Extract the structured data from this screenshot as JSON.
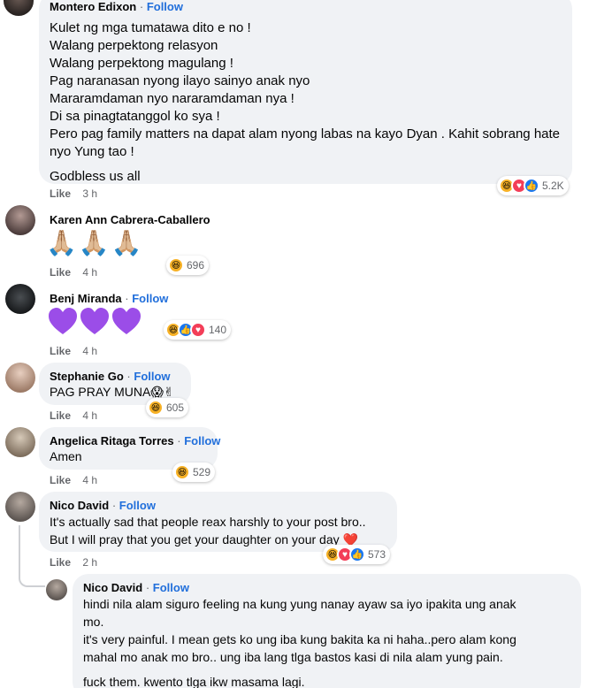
{
  "comments": [
    {
      "author": "Montero Edixon",
      "follow": "Follow",
      "lines": [
        "Kulet ng mga tumatawa dito e no !",
        "Walang perpektong relasyon",
        "Walang perpektong magulang !",
        "Pag naranasan nyong ilayo sainyo anak nyo",
        "Mararamdaman nyo nararamdaman nya !",
        "Di sa pinagtatanggol ko sya !",
        "Pero pag family matters na dapat alam nyong labas na kayo Dyan . Kahit sobrang hate",
        "nyo Yung tao !",
        "Godbless us all"
      ],
      "like": "Like",
      "time": "3 h",
      "reaction_count": "5.2K"
    },
    {
      "author": "Karen Ann Cabrera-Caballero",
      "text": "🙏🏼🙏🏼🙏🏼",
      "like": "Like",
      "time": "4 h",
      "reaction_count": "696"
    },
    {
      "author": "Benj Miranda",
      "follow": "Follow",
      "like": "Like",
      "time": "4 h",
      "reaction_count": "140"
    },
    {
      "author": "Stephanie Go",
      "follow": "Follow",
      "text": "PAG PRAY MUNA😱✌",
      "like": "Like",
      "time": "4 h",
      "reaction_count": "605"
    },
    {
      "author": "Angelica Ritaga Torres",
      "follow": "Follow",
      "text": "Amen",
      "like": "Like",
      "time": "4 h",
      "reaction_count": "529"
    },
    {
      "author": "Nico David",
      "follow": "Follow",
      "lines": [
        "It's actually sad that people reax harshly to your post bro..",
        "But I will pray that you get your daughter on your day ❤️"
      ],
      "like": "Like",
      "time": "2 h",
      "reaction_count": "573"
    }
  ],
  "reply": {
    "author": "Nico David",
    "follow": "Follow",
    "lines": [
      "hindi nila alam siguro feeling na kung yung nanay ayaw sa iyo ipakita ung anak",
      "mo.",
      "it's very painful. I mean gets ko ung iba kung bakita ka ni haha..pero alam kong",
      "mahal mo anak mo bro.. ung iba lang tlga bastos kasi di nila alam yung pain.",
      "fuck them. kwento tlga ikw masama lagi."
    ]
  },
  "separator": "·",
  "colors": {
    "bubble": "#f0f2f5",
    "follow": "#216fdb",
    "meta": "#65676b",
    "heart": "#8a2be2"
  }
}
